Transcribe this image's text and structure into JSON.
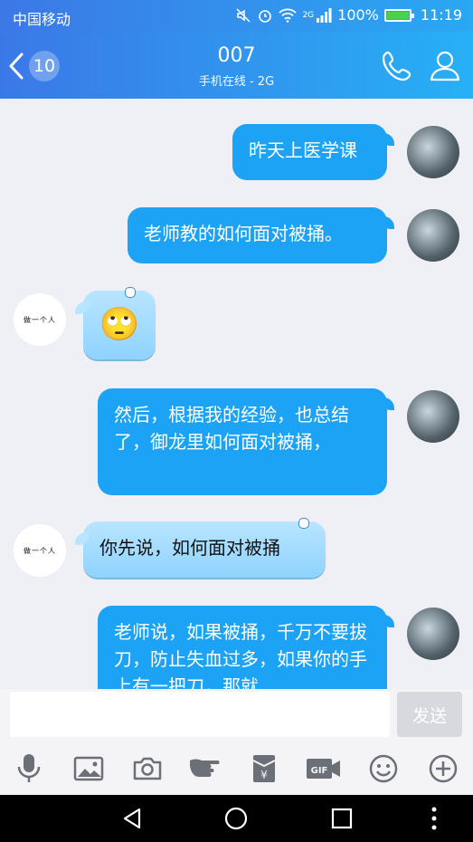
{
  "status_bar": {
    "carrier": "中国移动",
    "battery": "100%",
    "time": "11:19",
    "network": "2G"
  },
  "header": {
    "unread_count": "10",
    "title": "007",
    "subtitle": "手机在线 - 2G"
  },
  "messages": [
    {
      "sender": "me",
      "text": "昨天上医学课"
    },
    {
      "sender": "me",
      "text": "老师教的如何面对被捅。"
    },
    {
      "sender": "other",
      "type": "emoji",
      "emoji": "🙄"
    },
    {
      "sender": "me",
      "text": "然后，根据我的经验，也总结了，御龙里如何面对被捅，"
    },
    {
      "sender": "other",
      "text": "你先说，如何面对被捅"
    },
    {
      "sender": "me",
      "text": "老师说，如果被捅，千万不要拔刀，防止失血过多，如果你的手上有一把刀，那就"
    }
  ],
  "other_avatar_text": "做一个人",
  "input": {
    "placeholder": "",
    "send_label": "发送"
  },
  "toolbar": {
    "icons": [
      "mic-icon",
      "image-icon",
      "camera-icon",
      "poke-icon",
      "red-packet-icon",
      "gif-icon",
      "emoji-icon",
      "plus-icon"
    ]
  },
  "colors": {
    "accent": "#1ca3f5",
    "header_start": "#3b78e7",
    "header_end": "#27b0f5"
  }
}
